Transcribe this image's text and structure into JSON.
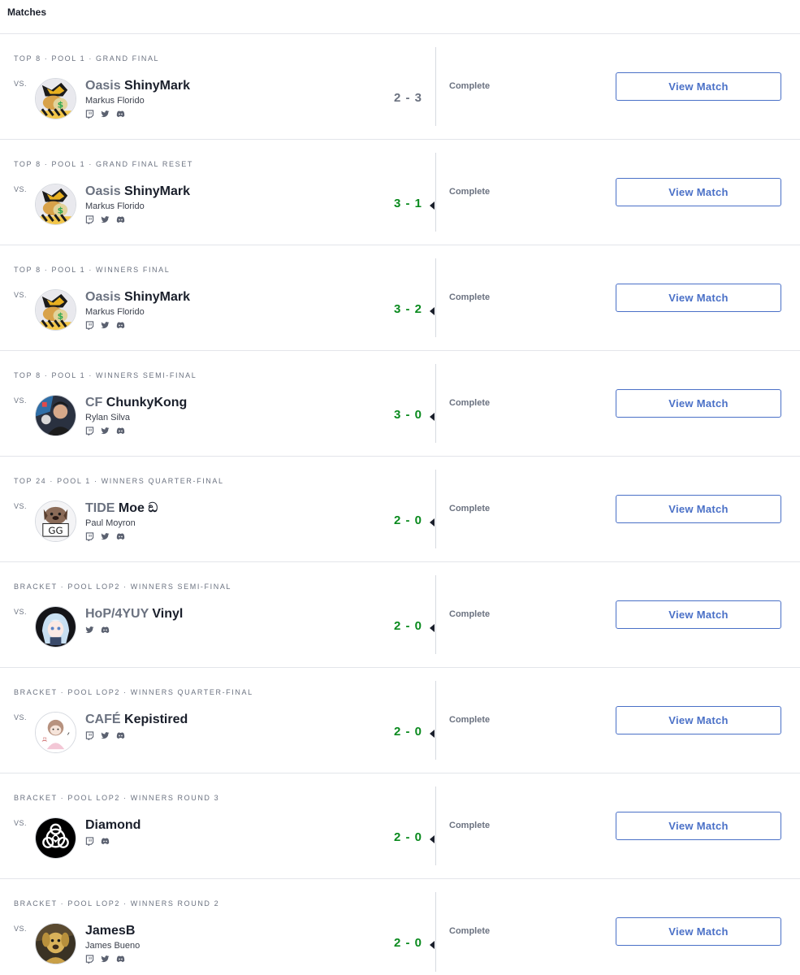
{
  "header": {
    "title": "Matches"
  },
  "colors": {
    "accent": "#4a70c7",
    "win": "#0a8a1e",
    "muted": "#6b7280"
  },
  "matches": [
    {
      "round": "TOP 8 · POOL 1 · GRAND FINAL",
      "vs": "VS.",
      "prefix": "Oasis",
      "gamertag": "ShinyMark",
      "realname": "Markus Florido",
      "avatar": "cartoon-avatar",
      "socials": [
        "twitch",
        "twitter",
        "discord"
      ],
      "score": "2 - 3",
      "won": false,
      "status": "Complete",
      "button": "View Match"
    },
    {
      "round": "TOP 8 · POOL 1 · GRAND FINAL RESET",
      "vs": "VS.",
      "prefix": "Oasis",
      "gamertag": "ShinyMark",
      "realname": "Markus Florido",
      "avatar": "cartoon-avatar",
      "socials": [
        "twitch",
        "twitter",
        "discord"
      ],
      "score": "3 - 1",
      "won": true,
      "status": "Complete",
      "button": "View Match"
    },
    {
      "round": "TOP 8 · POOL 1 · WINNERS FINAL",
      "vs": "VS.",
      "prefix": "Oasis",
      "gamertag": "ShinyMark",
      "realname": "Markus Florido",
      "avatar": "cartoon-avatar",
      "socials": [
        "twitch",
        "twitter",
        "discord"
      ],
      "score": "3 - 2",
      "won": true,
      "status": "Complete",
      "button": "View Match"
    },
    {
      "round": "TOP 8 · POOL 1 · WINNERS SEMI-FINAL",
      "vs": "VS.",
      "prefix": "CF",
      "gamertag": "ChunkyKong",
      "realname": "Rylan Silva",
      "avatar": "photo-avatar",
      "socials": [
        "twitch",
        "twitter",
        "discord"
      ],
      "score": "3 - 0",
      "won": true,
      "status": "Complete",
      "button": "View Match"
    },
    {
      "round": "TOP 24 · POOL 1 · WINNERS QUARTER-FINAL",
      "vs": "VS.",
      "prefix": "TIDE",
      "gamertag": "Moe ඞ",
      "realname": "Paul Moyron",
      "avatar": "dog-gg-avatar",
      "socials": [
        "twitch",
        "twitter",
        "discord"
      ],
      "score": "2 - 0",
      "won": true,
      "status": "Complete",
      "button": "View Match"
    },
    {
      "round": "BRACKET · POOL LOP2 · WINNERS SEMI-FINAL",
      "vs": "VS.",
      "prefix": "HoP/4YUY",
      "gamertag": "Vinyl",
      "realname": "",
      "avatar": "anime-avatar",
      "socials": [
        "twitter",
        "discord"
      ],
      "score": "2 - 0",
      "won": true,
      "status": "Complete",
      "button": "View Match"
    },
    {
      "round": "BRACKET · POOL LOP2 · WINNERS QUARTER-FINAL",
      "vs": "VS.",
      "prefix": "CAFÉ",
      "gamertag": "Kepistired",
      "realname": "",
      "avatar": "sketch-avatar",
      "socials": [
        "twitch",
        "twitter",
        "discord"
      ],
      "score": "2 - 0",
      "won": true,
      "status": "Complete",
      "button": "View Match"
    },
    {
      "round": "BRACKET · POOL LOP2 · WINNERS ROUND 3",
      "vs": "VS.",
      "prefix": "",
      "gamertag": "Diamond",
      "realname": "",
      "avatar": "biohazard-avatar",
      "socials": [
        "twitch",
        "discord"
      ],
      "score": "2 - 0",
      "won": true,
      "status": "Complete",
      "button": "View Match"
    },
    {
      "round": "BRACKET · POOL LOP2 · WINNERS ROUND 2",
      "vs": "VS.",
      "prefix": "",
      "gamertag": "JamesB",
      "realname": "James Bueno",
      "avatar": "dog-photo-avatar",
      "socials": [
        "twitch",
        "twitter",
        "discord"
      ],
      "score": "2 - 0",
      "won": true,
      "status": "Complete",
      "button": "View Match"
    }
  ]
}
